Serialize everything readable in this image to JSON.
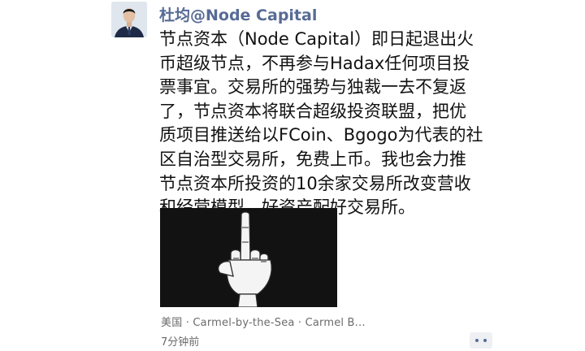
{
  "user": {
    "name": "杜均@Node Capital"
  },
  "post": {
    "lines": [
      "节点资本（Node Capital）即日起退出火",
      "币超级节点，不再参与Hadax任何项目投",
      "票事宜。交易所的强势与独裁一去不复返",
      "了，节点资本将联合超级投资联盟，把优",
      "质项目推送给以FCoin、Bgogo为代表的社",
      "区自治型交易所，免费上币。我也会力推",
      "节点资本所投资的10余家交易所改变营收",
      "和经营模型，好资产配好交易所。"
    ],
    "location": "美国 · Carmel-by-the-Sea · Carmel B...",
    "time": "7分钟前"
  },
  "icons": {
    "comment": "comment-icon",
    "avatar": "avatar-portrait",
    "photo": "hand-gesture-image"
  },
  "colors": {
    "name": "#576b95",
    "meta": "#6b6b6b",
    "comment_icon": "#576b95"
  }
}
